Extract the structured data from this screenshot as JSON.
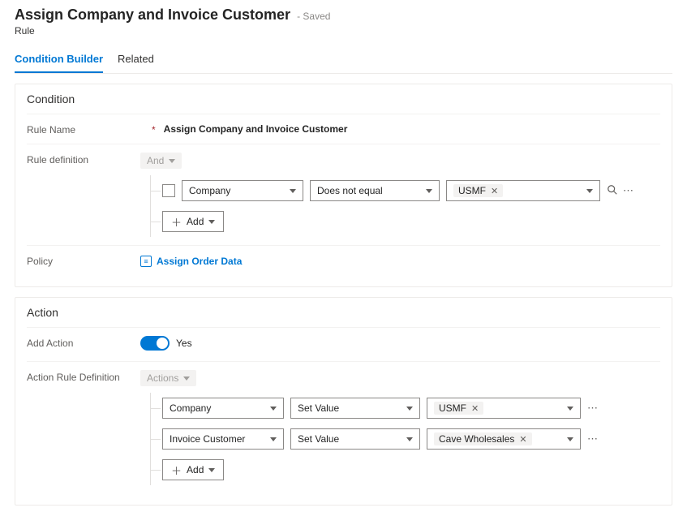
{
  "header": {
    "title": "Assign Company and Invoice Customer",
    "status_suffix": "- Saved",
    "subtitle": "Rule"
  },
  "tabs": [
    {
      "label": "Condition Builder",
      "active": true
    },
    {
      "label": "Related",
      "active": false
    }
  ],
  "condition": {
    "section_title": "Condition",
    "rule_name_label": "Rule Name",
    "rule_name_value": "Assign Company and Invoice Customer",
    "definition_label": "Rule definition",
    "root_logic": "And",
    "row1": {
      "field": "Company",
      "operator": "Does not equal",
      "value_tag": "USMF"
    },
    "add_label": "Add",
    "policy_label": "Policy",
    "policy_value": "Assign Order Data"
  },
  "action": {
    "section_title": "Action",
    "add_action_label": "Add Action",
    "add_action_toggle_label": "Yes",
    "definition_label": "Action Rule Definition",
    "root_logic": "Actions",
    "row1": {
      "field": "Company",
      "operator": "Set Value",
      "value_tag": "USMF"
    },
    "row2": {
      "field": "Invoice Customer",
      "operator": "Set Value",
      "value_tag": "Cave Wholesales"
    },
    "add_label": "Add"
  }
}
